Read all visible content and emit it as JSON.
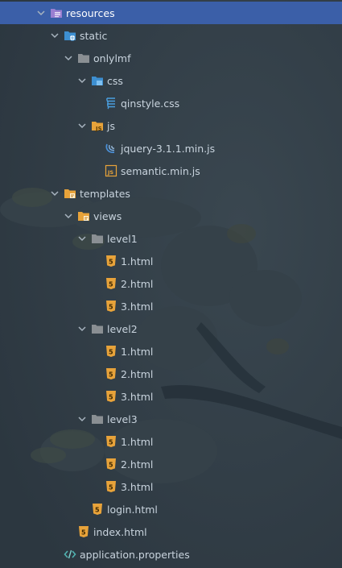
{
  "tree": {
    "items": [
      {
        "label": "resources",
        "icon": "resources-folder-icon",
        "expanded": true,
        "selected": true
      },
      {
        "label": "static",
        "icon": "web-folder-icon",
        "expanded": true
      },
      {
        "label": "onlylmf",
        "icon": "folder-icon",
        "expanded": true
      },
      {
        "label": "css",
        "icon": "css-folder-icon",
        "expanded": true
      },
      {
        "label": "qinstyle.css",
        "icon": "css-file-icon"
      },
      {
        "label": "js",
        "icon": "js-folder-icon",
        "expanded": true
      },
      {
        "label": "jquery-3.1.1.min.js",
        "icon": "jquery-file-icon"
      },
      {
        "label": "semantic.min.js",
        "icon": "js-file-icon"
      },
      {
        "label": "templates",
        "icon": "templates-folder-icon",
        "expanded": true
      },
      {
        "label": "views",
        "icon": "templates-folder-icon",
        "expanded": true
      },
      {
        "label": "level1",
        "icon": "folder-icon",
        "expanded": true
      },
      {
        "label": "1.html",
        "icon": "html-file-icon"
      },
      {
        "label": "2.html",
        "icon": "html-file-icon"
      },
      {
        "label": "3.html",
        "icon": "html-file-icon"
      },
      {
        "label": "level2",
        "icon": "folder-icon",
        "expanded": true
      },
      {
        "label": "1.html",
        "icon": "html-file-icon"
      },
      {
        "label": "2.html",
        "icon": "html-file-icon"
      },
      {
        "label": "3.html",
        "icon": "html-file-icon"
      },
      {
        "label": "level3",
        "icon": "folder-icon",
        "expanded": true
      },
      {
        "label": "1.html",
        "icon": "html-file-icon"
      },
      {
        "label": "2.html",
        "icon": "html-file-icon"
      },
      {
        "label": "3.html",
        "icon": "html-file-icon"
      },
      {
        "label": "login.html",
        "icon": "html-file-icon"
      },
      {
        "label": "index.html",
        "icon": "html-file-icon"
      },
      {
        "label": "application.properties",
        "icon": "properties-file-icon"
      }
    ]
  },
  "colors": {
    "background": "#2f3b45",
    "selection": "#3b5fa8",
    "text": "#c9d4de",
    "folder_gray": "#8a8f93",
    "folder_blue": "#3d8fd1",
    "folder_orange": "#e8a33a",
    "html_orange": "#e8a33a",
    "css_blue": "#4a9fe0",
    "properties_teal": "#4fb3b0"
  }
}
